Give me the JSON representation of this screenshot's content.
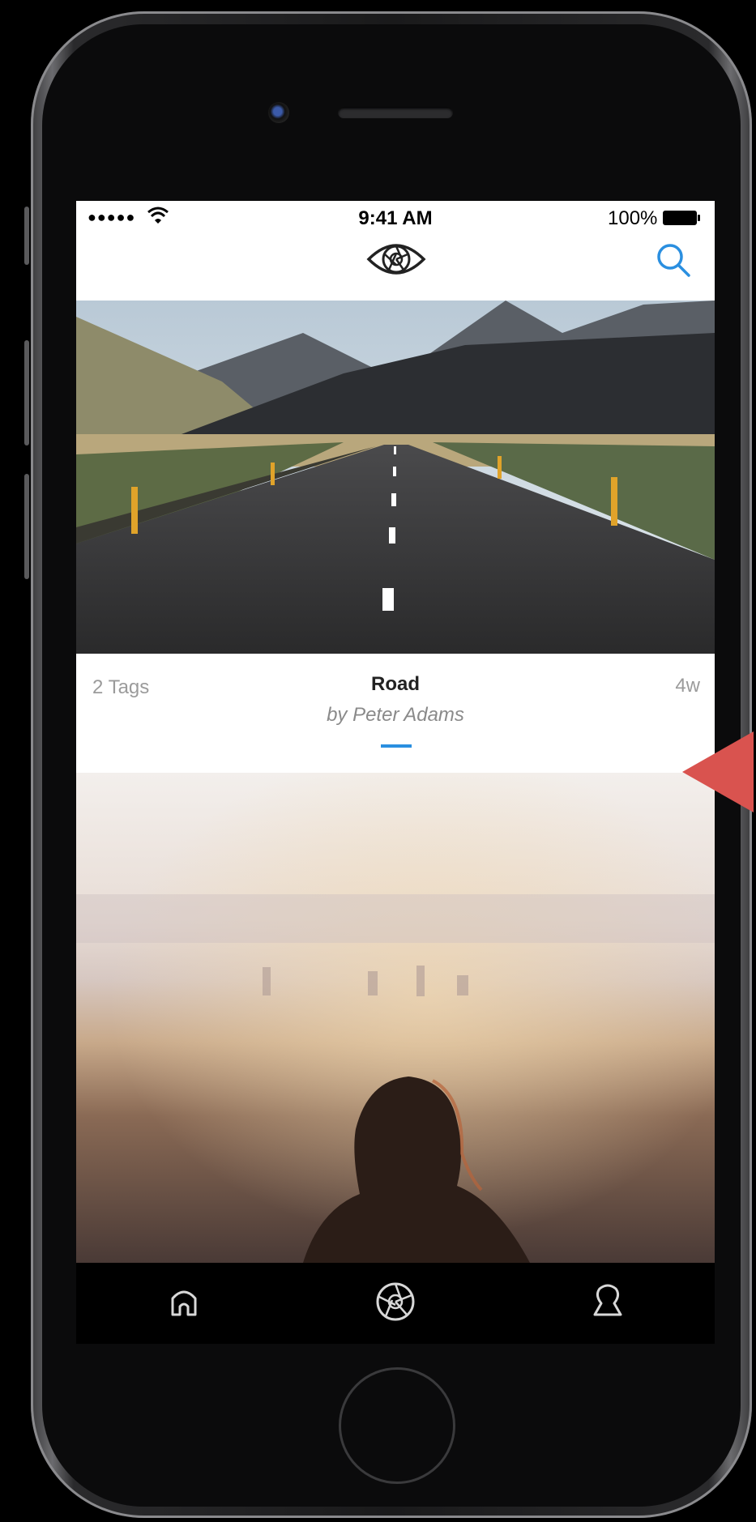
{
  "status_bar": {
    "signal": "●●●●●",
    "time": "9:41 AM",
    "battery": "100%"
  },
  "nav_bar": {
    "logo_icon": "aperture-eye-icon",
    "search_icon": "search-icon"
  },
  "post": {
    "tags": "2 Tags",
    "title": "Road",
    "author": "by Peter Adams",
    "age": "4w"
  },
  "tab_bar": {
    "items": [
      "home-icon",
      "aperture-icon",
      "profile-icon"
    ]
  },
  "colors": {
    "accent": "#2a8fe0",
    "arrow": "#d9534f"
  }
}
